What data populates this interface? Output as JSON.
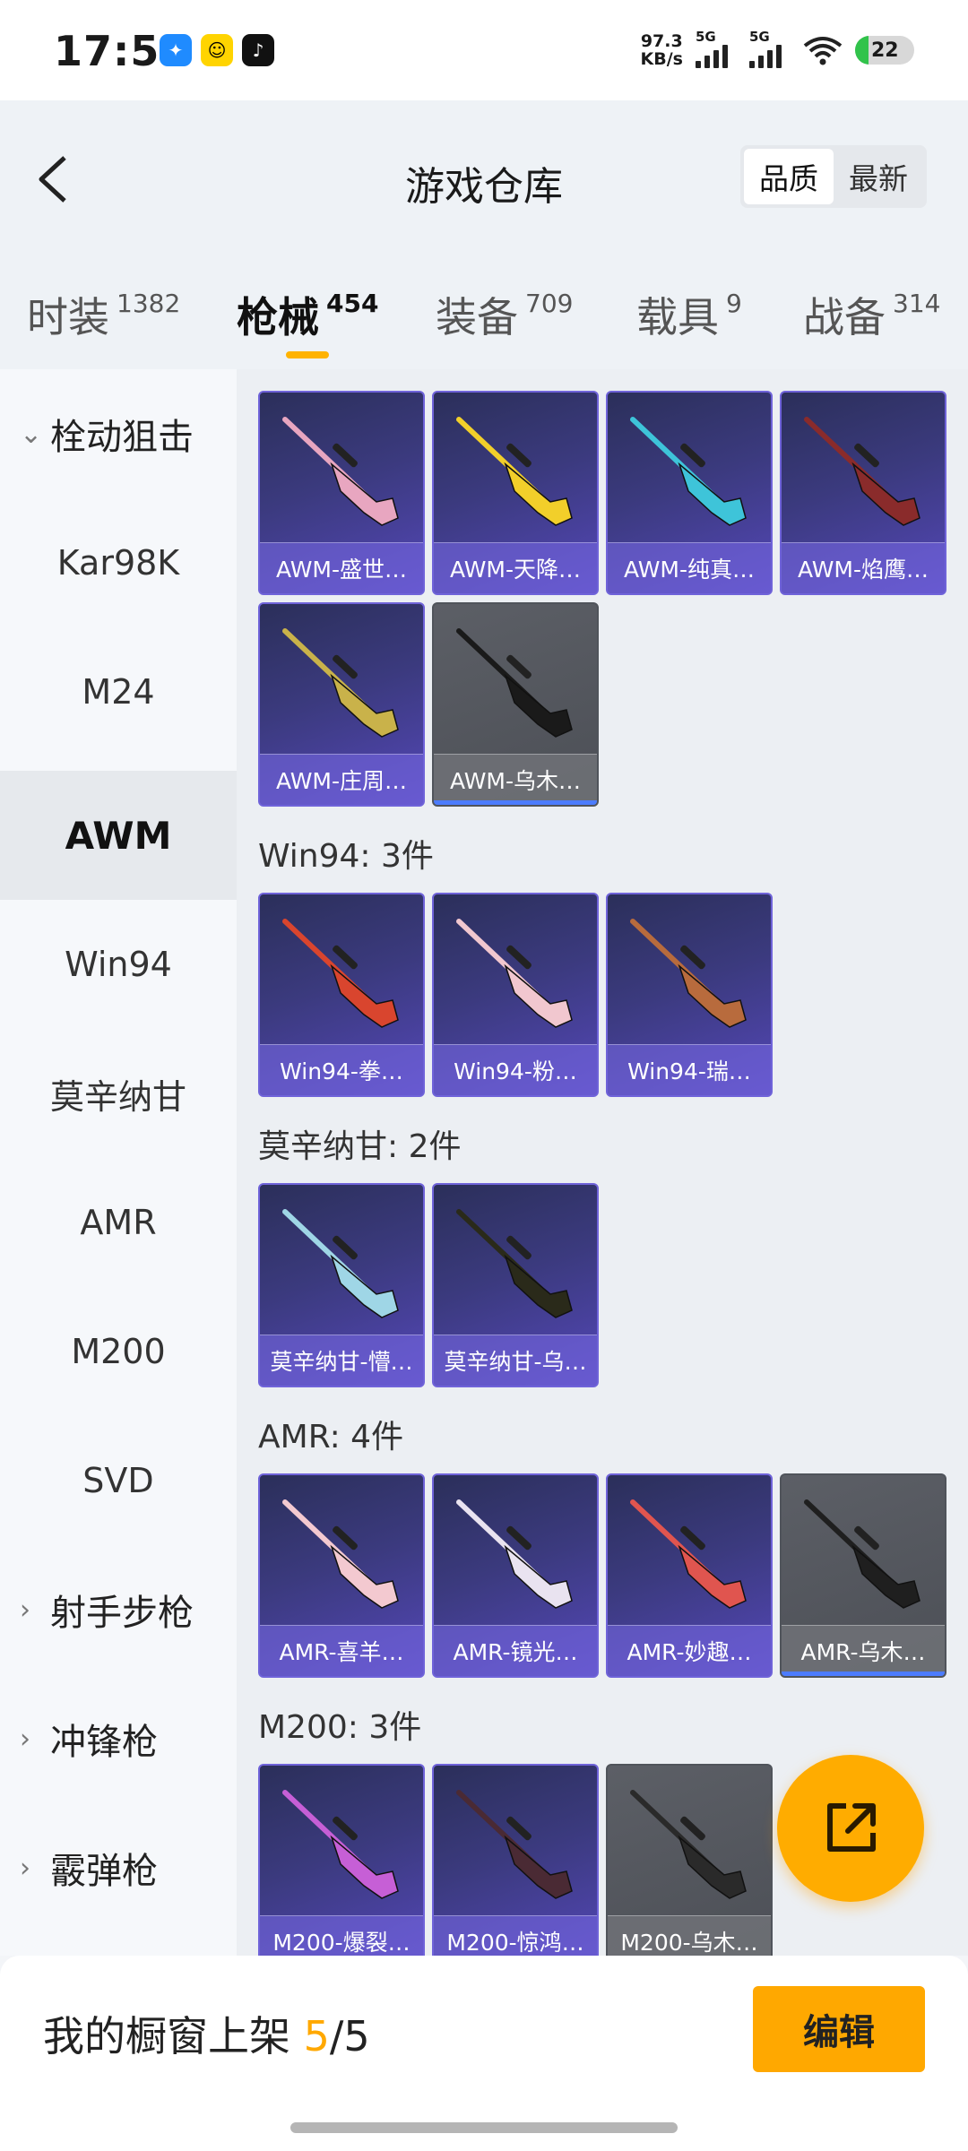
{
  "status_bar": {
    "time": "17:56",
    "net_speed": "97.3",
    "net_unit": "KB/s",
    "sig1_label": "5G",
    "sig2_label": "5G",
    "battery": "22"
  },
  "header": {
    "title": "游戏仓库",
    "sort_options": [
      "品质",
      "最新"
    ],
    "sort_active": "品质"
  },
  "tabs": [
    {
      "label": "时装",
      "count": "1382"
    },
    {
      "label": "枪械",
      "count": "454"
    },
    {
      "label": "装备",
      "count": "709"
    },
    {
      "label": "载具",
      "count": "9"
    },
    {
      "label": "战备",
      "count": "314"
    }
  ],
  "active_tab": "枪械",
  "sidebar": {
    "category_open": "栓动狙击",
    "items": [
      "Kar98K",
      "M24",
      "AWM",
      "Win94",
      "莫辛纳甘",
      "AMR",
      "M200",
      "SVD"
    ],
    "active_item": "AWM",
    "other_categories": [
      "射手步枪",
      "冲锋枪",
      "霰弹枪"
    ]
  },
  "sections": [
    {
      "title": "",
      "items": [
        {
          "name": "AWM-盛世…",
          "rarity": "purple",
          "color": "#e8a6c0"
        },
        {
          "name": "AWM-天降…",
          "rarity": "purple",
          "color": "#f2cf2a"
        },
        {
          "name": "AWM-纯真…",
          "rarity": "purple",
          "color": "#3ec4d9"
        },
        {
          "name": "AWM-焰鹰…",
          "rarity": "purple",
          "color": "#8a2b2b"
        },
        {
          "name": "AWM-庄周…",
          "rarity": "purple",
          "color": "#c9b24a"
        },
        {
          "name": "AWM-乌木…",
          "rarity": "grey",
          "color": "#1a1a1a"
        }
      ]
    },
    {
      "title": "Win94: 3件",
      "items": [
        {
          "name": "Win94-拳…",
          "rarity": "purple",
          "color": "#d9452e"
        },
        {
          "name": "Win94-粉…",
          "rarity": "purple",
          "color": "#f1c7cf"
        },
        {
          "name": "Win94-瑞…",
          "rarity": "purple",
          "color": "#b86b3d"
        }
      ]
    },
    {
      "title": "莫辛纳甘: 2件",
      "items": [
        {
          "name": "莫辛纳甘-懵…",
          "rarity": "purple",
          "color": "#9fd6e6"
        },
        {
          "name": "莫辛纳甘-乌…",
          "rarity": "purple",
          "color": "#2a2a1a"
        }
      ]
    },
    {
      "title": "AMR: 4件",
      "items": [
        {
          "name": "AMR-喜羊…",
          "rarity": "purple",
          "color": "#f3c9d0"
        },
        {
          "name": "AMR-镜光…",
          "rarity": "purple",
          "color": "#e9e3f0"
        },
        {
          "name": "AMR-妙趣…",
          "rarity": "purple",
          "color": "#e0554f"
        },
        {
          "name": "AMR-乌木…",
          "rarity": "grey",
          "color": "#1f1f1f"
        }
      ]
    },
    {
      "title": "M200: 3件",
      "items": [
        {
          "name": "M200-爆裂…",
          "rarity": "purple",
          "color": "#c65fd6"
        },
        {
          "name": "M200-惊鸿…",
          "rarity": "purple",
          "color": "#4a2a34"
        },
        {
          "name": "M200-乌木…",
          "rarity": "grey",
          "color": "#2a2a2a"
        }
      ]
    }
  ],
  "bottom_bar": {
    "text": "我的橱窗上架 ",
    "current": "5",
    "total": "/5",
    "edit_label": "编辑"
  }
}
